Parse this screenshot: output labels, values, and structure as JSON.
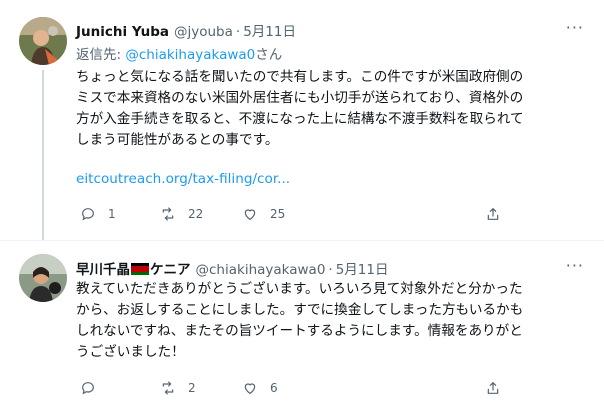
{
  "tweets": [
    {
      "author_name": "Junichi Yuba",
      "author_handle": "@jyouba",
      "separator": "·",
      "timestamp": "5月11日",
      "replying_prefix": "返信先: ",
      "replying_to": "@chiakihayakawa0",
      "replying_suffix": "さん",
      "text": "ちょっと気になる話を聞いたので共有します。この件ですが米国政府側の\nミスで本来資格のない米国外居住者にも小切手が送られており、資格外の\n方が入金手続きを取ると、不渡になった上に結構な不渡手数料を取られて\nしまう可能性があるとの事です。",
      "link": "eitcoutreach.org/tax-filing/cor...",
      "actions": {
        "reply_icon": "reply-icon",
        "reply_count": "1",
        "retweet_icon": "retweet-icon",
        "retweet_count": "22",
        "like_icon": "heart-icon",
        "like_count": "25",
        "share_icon": "share-icon"
      }
    },
    {
      "author_name_prefix": "早川千晶",
      "author_name_suffix": "ケニア",
      "author_handle": "@chiakihayakawa0",
      "separator": "·",
      "timestamp": "5月11日",
      "text": "教えていただきありがとうございます。いろいろ見て対象外だと分かった\nから、お返しすることにしました。すでに換金してしまった方もいるかも\nしれないですね、またその旨ツイートするようにします。情報をありがと\nうございました！",
      "actions": {
        "reply_icon": "reply-icon",
        "retweet_icon": "retweet-icon",
        "retweet_count": "2",
        "like_icon": "heart-icon",
        "like_count": "6",
        "share_icon": "share-icon"
      }
    }
  ],
  "more_icon": "more-icon",
  "colors": {
    "accent": "#1d9bf0",
    "secondary_text": "#536471",
    "thread_line": "#cfd9de"
  }
}
